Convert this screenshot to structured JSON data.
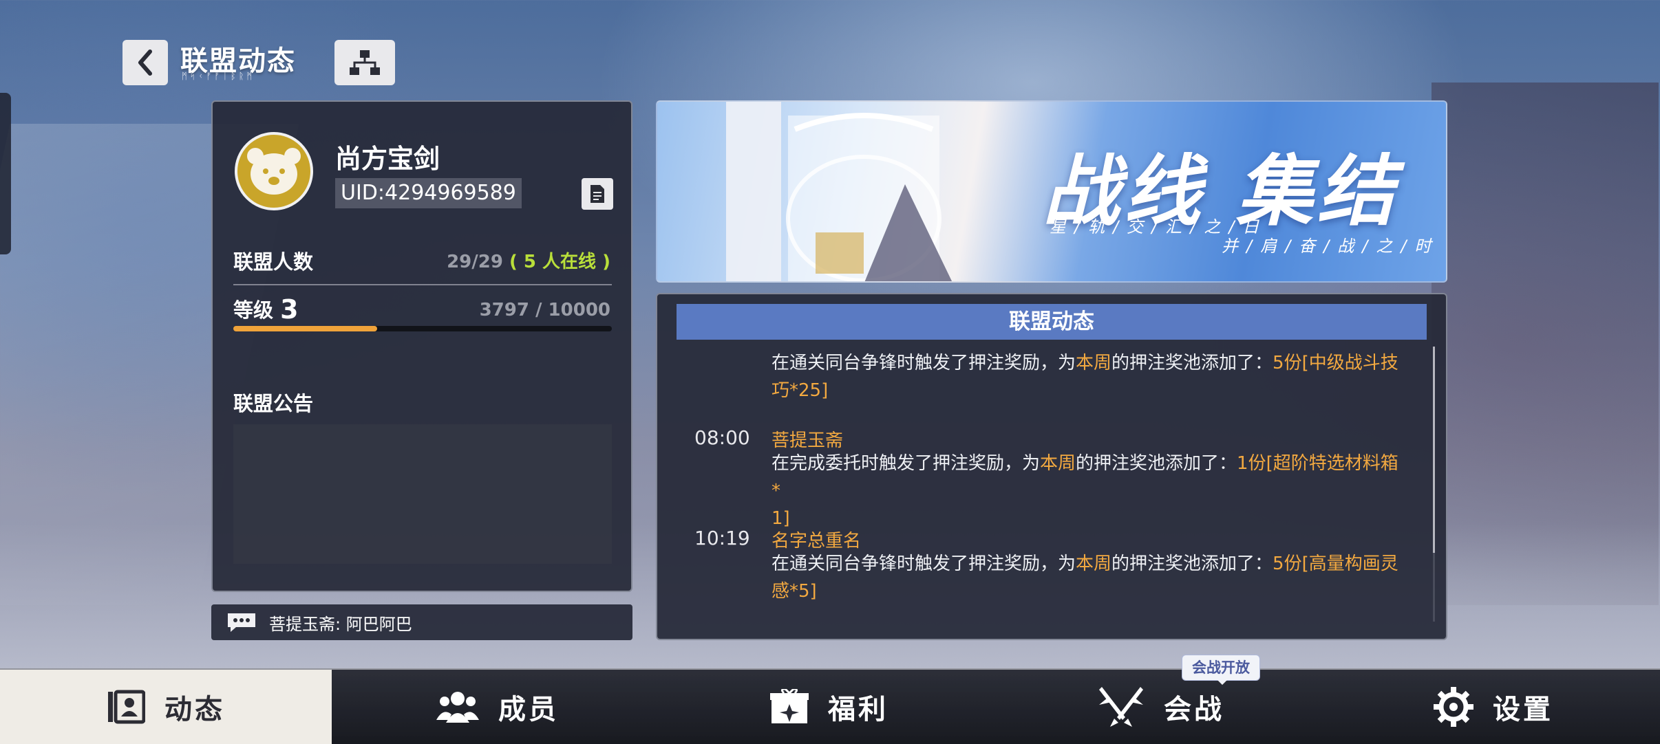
{
  "header": {
    "title": "联盟动态",
    "subtitle": "ᛗᛋᚲᚠᚠᛁᛒᚱᛗ"
  },
  "guild": {
    "name": "尚方宝剑",
    "uid": "UID:4294969589",
    "members_label": "联盟人数",
    "members_value": "29/29",
    "online_text": "( 5 人在线 )",
    "level_label": "等级",
    "level_value": "3",
    "exp_text": "3797 / 10000",
    "exp_progress": 0.3797,
    "notice_label": "联盟公告",
    "notice_text": ""
  },
  "chat": {
    "message": "菩提玉斋: 阿巴阿巴"
  },
  "banner": {
    "title": "战线 集结",
    "subtitle_left": "星/轨/交/汇/之/日",
    "subtitle_right": "并/肩/奋/战/之/时"
  },
  "log": {
    "header": "联盟动态",
    "entries": [
      {
        "time": "",
        "name": "",
        "pre": "在通关同台争锋时触发了押注奖励，为",
        "week": "本周",
        "mid": "的押注奖池添加了：",
        "reward": "5份[中级战斗技",
        "reward2": "巧*25]"
      },
      {
        "time": "08:00",
        "name": "菩提玉斋",
        "pre": "在完成委托时触发了押注奖励，为",
        "week": "本周",
        "mid": "的押注奖池添加了：",
        "reward": "1份[超阶特选材料箱*",
        "reward2": "1]"
      },
      {
        "time": "10:19",
        "name": "名字总重名",
        "pre": "在通关同台争锋时触发了押注奖励，为",
        "week": "本周",
        "mid": "的押注奖池添加了：",
        "reward": "5份[高量构画灵",
        "reward2": "感*5]"
      }
    ]
  },
  "nav": {
    "items": [
      {
        "label": "动态",
        "icon": "profile-card-icon",
        "active": true
      },
      {
        "label": "成员",
        "icon": "members-icon",
        "active": false
      },
      {
        "label": "福利",
        "icon": "gift-box-icon",
        "active": false
      },
      {
        "label": "会战",
        "icon": "crossed-swords-icon",
        "active": false
      },
      {
        "label": "设置",
        "icon": "gear-icon",
        "active": false
      }
    ],
    "badge": "会战开放"
  },
  "colors": {
    "accent_orange": "#f3a940",
    "online_green": "#b9df3a",
    "log_header_blue": "#5a7ac2",
    "avatar_gold": "#c9a52a"
  }
}
